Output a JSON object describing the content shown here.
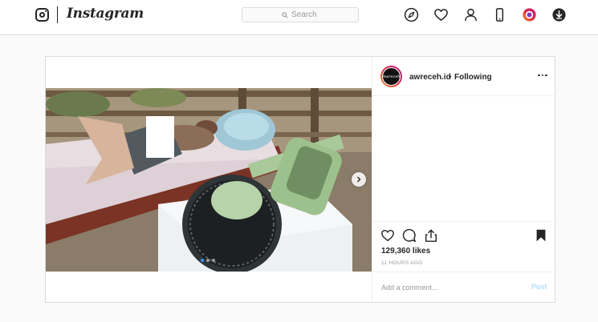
{
  "nav": {
    "brand": "Instagram",
    "search": {
      "placeholder": "Search",
      "value": ""
    },
    "icons": [
      "compass-icon",
      "heart-icon",
      "profile-icon",
      "phone-icon",
      "stories-icon",
      "download-icon"
    ]
  },
  "post": {
    "author": {
      "username": "awreceh.id",
      "separator": "•",
      "follow_status": "Following",
      "avatar_text": "Awreceh"
    },
    "carousel": {
      "slide_count": 3,
      "current_slide": 1
    },
    "likes_text": "129,360 likes",
    "timestamp": "11 HOURS AGO",
    "comment": {
      "placeholder": "Add a comment...",
      "value": "",
      "post_label": "Post"
    }
  },
  "colors": {
    "accent": "#3897f0",
    "post_disabled": "#b2dffc",
    "border": "#dbdbdb"
  }
}
